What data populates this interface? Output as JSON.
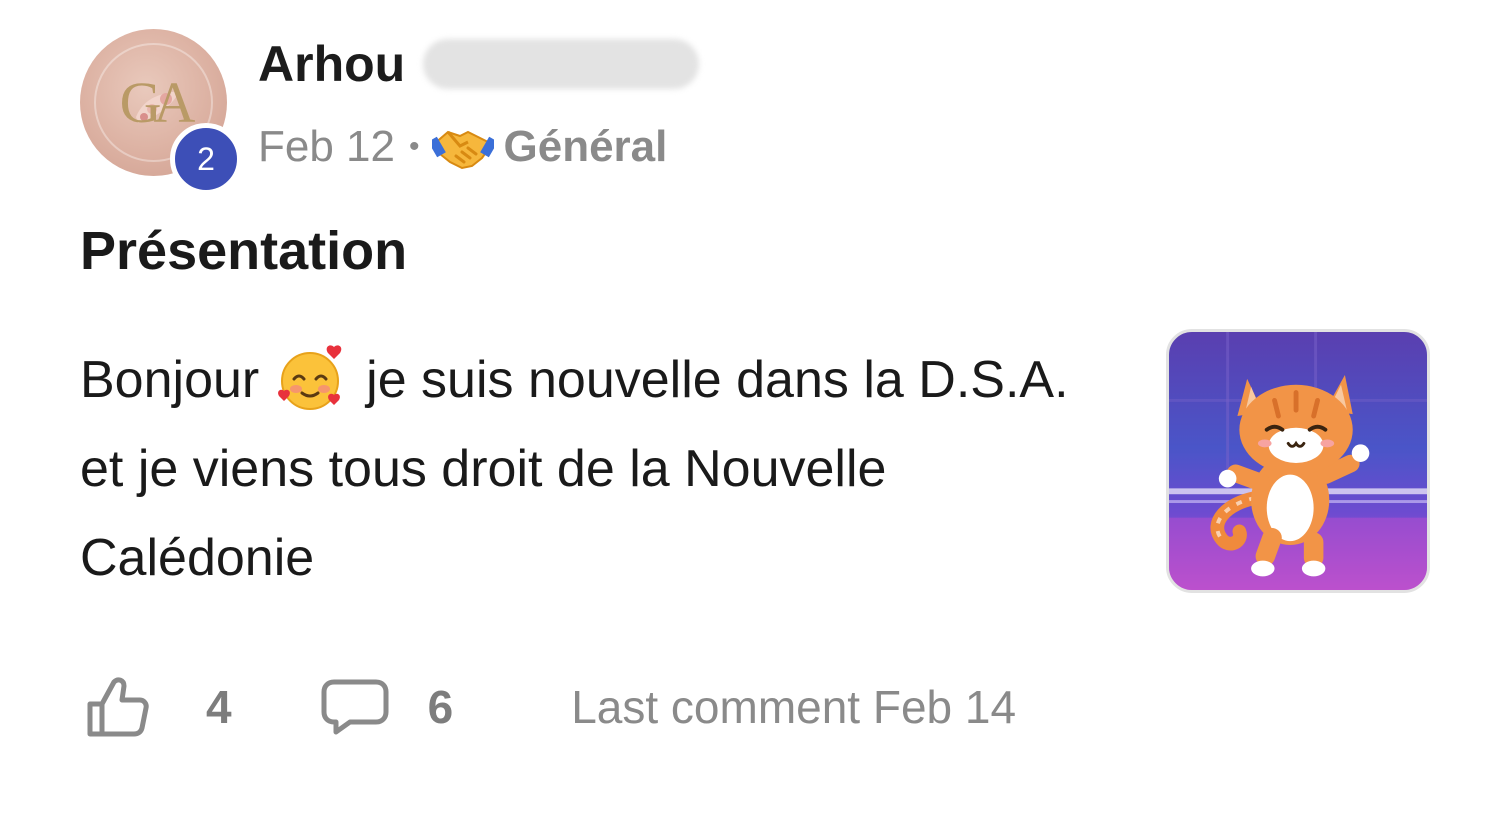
{
  "post": {
    "author": {
      "name": "Arhou",
      "avatar_monogram": "GA",
      "level": "2"
    },
    "meta": {
      "date": "Feb 12",
      "separator": "•",
      "category": "Général",
      "category_icon": "handshake-icon"
    },
    "title": "Présentation",
    "body": {
      "part1": "Bonjour",
      "emoji": "smiling-face-with-hearts-icon",
      "part2": "je suis nouvelle dans la D.S.A. et je viens tous droit de la Nouvelle Calédonie"
    },
    "thumbnail": {
      "alt": "dancing-cat-image"
    },
    "footer": {
      "likes": "4",
      "comments": "6",
      "last_comment": "Last comment Feb 14"
    }
  },
  "colors": {
    "badge": "#3d4fb7",
    "meta_text": "#8a8a8a",
    "text": "#1a1a1a"
  }
}
